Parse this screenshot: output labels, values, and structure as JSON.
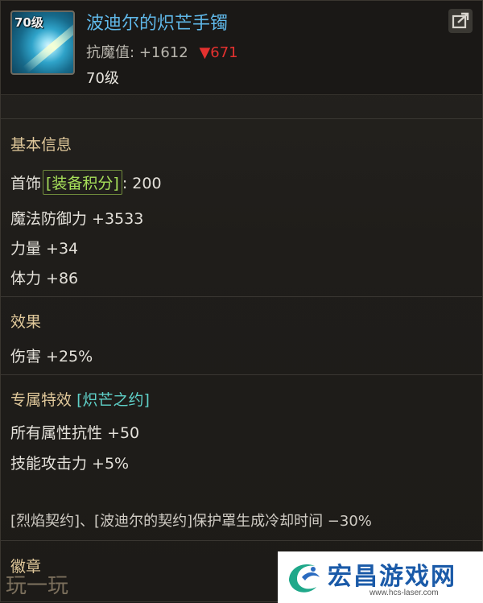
{
  "item": {
    "name": "波迪尔的炽芒手镯",
    "icon_level": "70级",
    "stat_label": "抗魔值:",
    "stat_value": "+1612",
    "stat_diff": "▼671",
    "level": "70级"
  },
  "basic": {
    "title": "基本信息",
    "slot": "首饰",
    "score_label": "[装备积分]",
    "score_value": ": 200",
    "stats": [
      "魔法防御力 +3533",
      "力量 +34",
      "体力 +86"
    ]
  },
  "effect": {
    "title": "效果",
    "lines": [
      "伤害 +25%"
    ]
  },
  "special": {
    "title": "专属特效",
    "name": "[炽芒之约]",
    "lines": [
      "所有属性抗性 +50",
      "技能攻击力 +5%"
    ],
    "description": "[烈焰契约]、[波迪尔的契约]保护罩生成冷却时间 −30%"
  },
  "badge": {
    "title": "徽章"
  },
  "watermark": {
    "left_text": "玩一玩",
    "logo_text": "宏昌游戏网",
    "logo_url": "www.hcs-laser.com"
  },
  "colors": {
    "item_name": "#5fb7e8",
    "down": "#e4312f",
    "tag_border": "#6f8a3c",
    "special": "#5fd0c8"
  }
}
